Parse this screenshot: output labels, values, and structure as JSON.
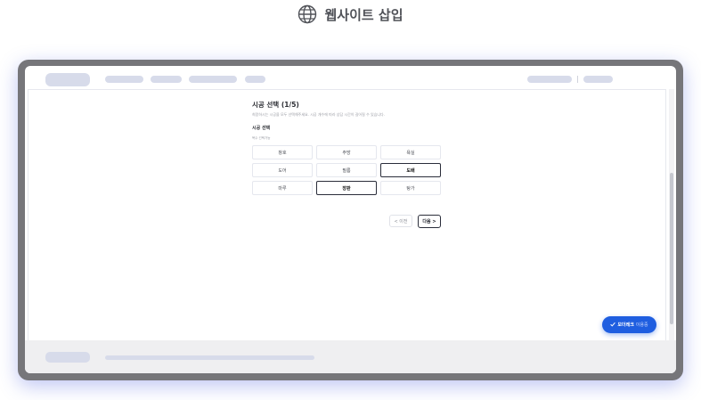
{
  "caption": {
    "icon": "globe-icon",
    "text": "웹사이트 삽입"
  },
  "page": {
    "title": "시공 선택 (1/5)",
    "subtitle": "희망하시는 시공을 모두 선택해주세요. 시공 개수에 따라 상담 시간이 길어질 수 있습니다.",
    "section_label": "시공 선택",
    "section_hint": "복수 선택가능",
    "options": [
      {
        "label": "창호",
        "selected": false
      },
      {
        "label": "주방",
        "selected": false
      },
      {
        "label": "욕실",
        "selected": false
      },
      {
        "label": "도어",
        "selected": false
      },
      {
        "label": "필름",
        "selected": false
      },
      {
        "label": "도배",
        "selected": true
      },
      {
        "label": "마루",
        "selected": false
      },
      {
        "label": "장판",
        "selected": true
      },
      {
        "label": "탕가",
        "selected": false
      }
    ],
    "prev_label": "< 이전",
    "next_label": "다음 >"
  },
  "fab": {
    "icon": "check-icon",
    "strong_text": "모더레크",
    "weak_text": "이용중"
  },
  "colors": {
    "accent": "#1f5ee0",
    "frame": "#76767a",
    "placeholder": "#d7dbea",
    "footer": "#efeff1"
  }
}
